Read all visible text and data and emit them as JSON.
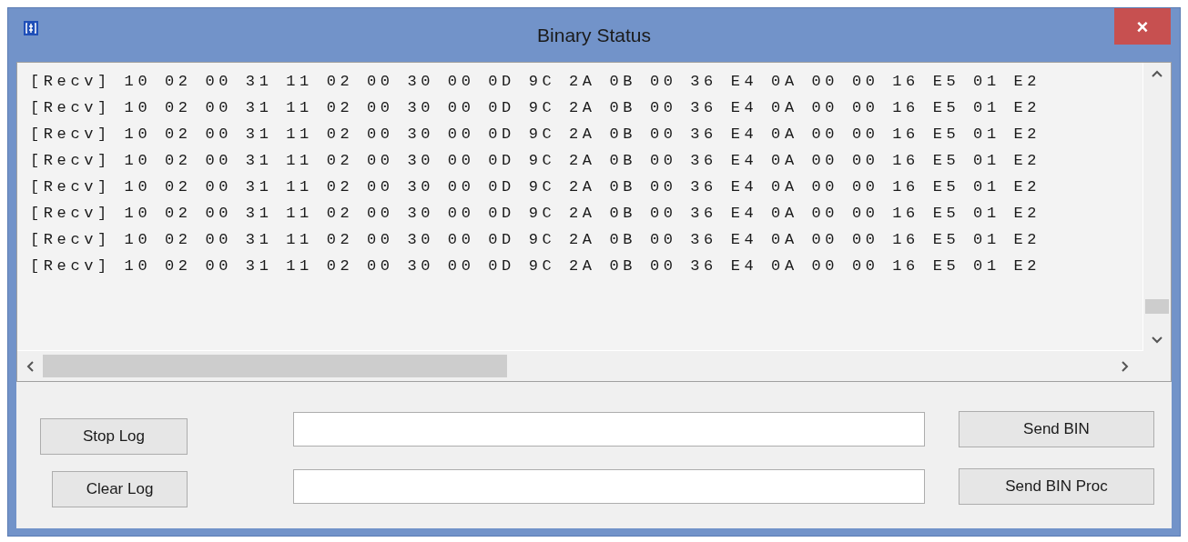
{
  "window": {
    "title": "Binary Status",
    "close": "×"
  },
  "log": {
    "lines": [
      "[Recv] 10 02 00 31 11 02 00 30 00 0D 9C 2A 0B 00 36 E4 0A 00 00 16 E5 01 E2",
      "[Recv] 10 02 00 31 11 02 00 30 00 0D 9C 2A 0B 00 36 E4 0A 00 00 16 E5 01 E2",
      "[Recv] 10 02 00 31 11 02 00 30 00 0D 9C 2A 0B 00 36 E4 0A 00 00 16 E5 01 E2",
      "[Recv] 10 02 00 31 11 02 00 30 00 0D 9C 2A 0B 00 36 E4 0A 00 00 16 E5 01 E2",
      "[Recv] 10 02 00 31 11 02 00 30 00 0D 9C 2A 0B 00 36 E4 0A 00 00 16 E5 01 E2",
      "[Recv] 10 02 00 31 11 02 00 30 00 0D 9C 2A 0B 00 36 E4 0A 00 00 16 E5 01 E2",
      "[Recv] 10 02 00 31 11 02 00 30 00 0D 9C 2A 0B 00 36 E4 0A 00 00 16 E5 01 E2",
      "[Recv] 10 02 00 31 11 02 00 30 00 0D 9C 2A 0B 00 36 E4 0A 00 00 16 E5 01 E2"
    ]
  },
  "controls": {
    "stop_log": "Stop Log",
    "clear_log": "Clear Log",
    "send_bin": "Send BIN",
    "send_bin_proc": "Send BIN Proc"
  }
}
